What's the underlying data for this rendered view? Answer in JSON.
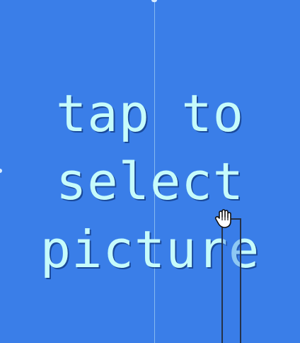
{
  "screen": {
    "background_color": "#3a7ee8",
    "text_color": "#c6fbfb"
  },
  "prompt": {
    "line1": "tap to",
    "line2": "select",
    "line3": "picture"
  },
  "cursor": {
    "icon": "hand-pointer-icon"
  }
}
